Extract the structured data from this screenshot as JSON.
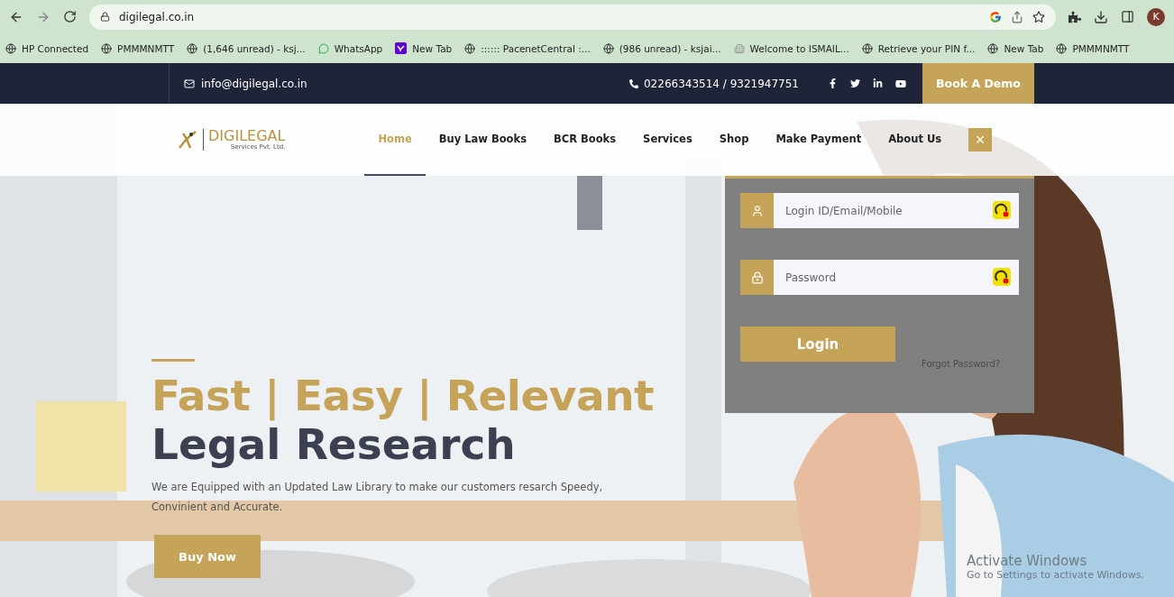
{
  "browser": {
    "url": "digilegal.co.in",
    "profile_initial": "K",
    "bookmarks": [
      {
        "label": "HP Connected",
        "kind": "globe"
      },
      {
        "label": "PMMMNMTT",
        "kind": "globe"
      },
      {
        "label": "(1,646 unread) - ksj...",
        "kind": "globe"
      },
      {
        "label": "WhatsApp",
        "kind": "chat"
      },
      {
        "label": "New Tab",
        "kind": "square"
      },
      {
        "label": ":::::: PacenetCentral :...",
        "kind": "globe"
      },
      {
        "label": "(986 unread) - ksjai...",
        "kind": "globe"
      },
      {
        "label": "Welcome to ISMAIL...",
        "kind": "building"
      },
      {
        "label": "Retrieve your PIN f...",
        "kind": "globe"
      },
      {
        "label": "New Tab",
        "kind": "globe"
      },
      {
        "label": "PMMMNMTT",
        "kind": "globe"
      }
    ]
  },
  "topbar": {
    "email": "info@digilegal.co.in",
    "phone": "02266343514 / 9321947751",
    "cta": "Book A Demo"
  },
  "nav": {
    "logo": {
      "name": "DIGILEGAL",
      "subtitle": "Services Pvt. Ltd."
    },
    "items": [
      {
        "label": "Home",
        "selected": true
      },
      {
        "label": "Buy Law Books",
        "selected": false
      },
      {
        "label": "BCR Books",
        "selected": false
      },
      {
        "label": "Services",
        "selected": false
      },
      {
        "label": "Shop",
        "selected": false
      },
      {
        "label": "Make Payment",
        "selected": false
      },
      {
        "label": "About Us",
        "selected": false
      }
    ],
    "close": "×"
  },
  "login": {
    "fields": [
      {
        "kind": "user",
        "placeholder": "Login ID/Email/Mobile"
      },
      {
        "kind": "password",
        "placeholder": "Password"
      }
    ],
    "button": "Login",
    "forgot": "Forgot Password?"
  },
  "hero": {
    "headline": "Fast | Easy | Relevant",
    "subheadline": "Legal Research",
    "description": "We are Equipped with an Updated Law Library to make our customers resarch Speedy, Convinient and Accurate.",
    "button": "Buy Now"
  },
  "os_notice": {
    "title": "Activate Windows",
    "text": "Go to Settings to activate Windows."
  }
}
